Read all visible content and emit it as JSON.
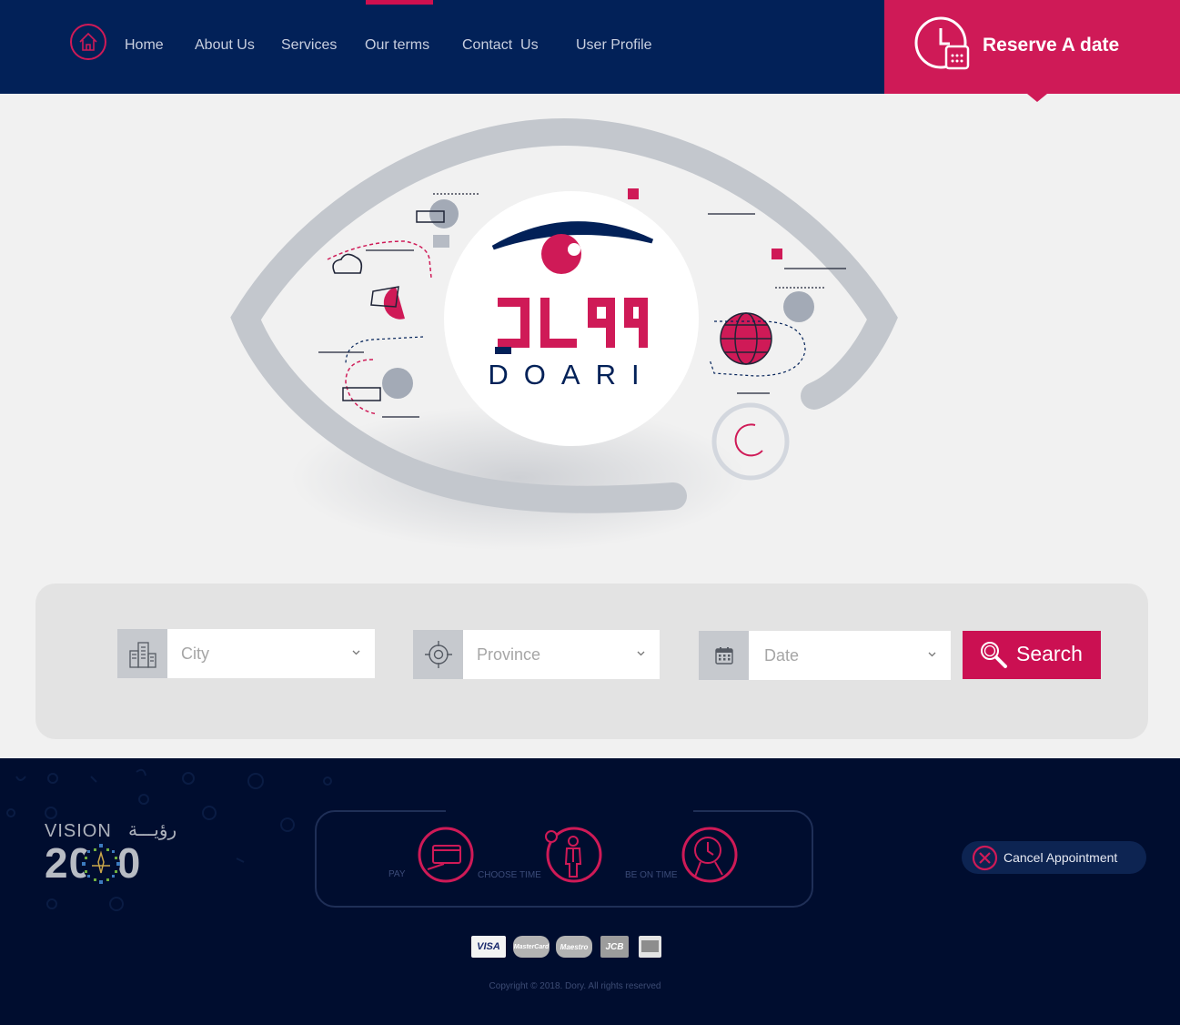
{
  "nav": {
    "items": [
      "Home",
      "About Us",
      "Services",
      "Our terms",
      "Contact  Us",
      "User Profile"
    ],
    "reserve_label": "Reserve A date"
  },
  "hero": {
    "logo_text": "DOARI",
    "logo_arabic": "دوري"
  },
  "search": {
    "city_placeholder": "City",
    "province_placeholder": "Province",
    "date_placeholder": "Date",
    "search_label": "Search"
  },
  "footer": {
    "vision_label": "VISION",
    "vision_arabic": "رؤيـــة",
    "vision_year": "2030",
    "steps": [
      "PAY",
      "CHOOSE TIME",
      "BE ON TIME"
    ],
    "cancel_label": "Cancel Appointment",
    "cards": [
      "VISA",
      "MasterCard",
      "Maestro",
      "JCB",
      "AMEX"
    ],
    "copyright": "Copyright © 2018. Dory. All rights reserved"
  },
  "colors": {
    "navy": "#022158",
    "accent": "#cf1a57",
    "footer_bg": "#000d2f"
  }
}
